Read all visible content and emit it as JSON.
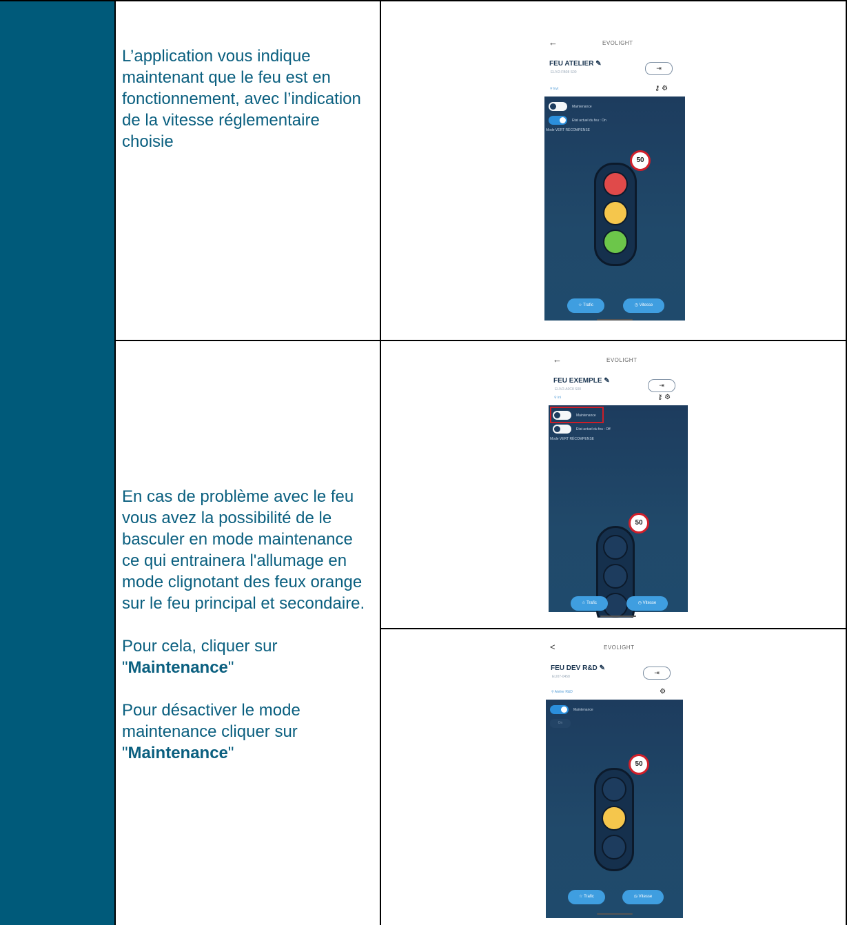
{
  "instructions": {
    "row1_text": "L’application vous indique maintenant que le feu est en fonctionnement, avec l’indication de la vitesse réglementaire choisie",
    "row2_para1": "En cas de problème avec le feu vous avez la possibilité de le basculer en mode maintenance ce qui entrainera l'allumage en mode clignotant des feux orange sur le feu principal et secondaire.",
    "row2_para2_prefix": "Pour cela, cliquer sur",
    "row2_para2_bold": "Maintenance",
    "row2_para3_prefix": "Pour désactiver le mode maintenance cliquer sur",
    "row2_para3_bold": "Maintenance",
    "quote": "\""
  },
  "screens": [
    {
      "back": "←",
      "brand": "EVOLIGHT",
      "device_name": "FEU ATELIER",
      "serial": "ELIV2-FB08 S00",
      "exit_icon": "exit-icon",
      "location": "Evt",
      "show_key_icon": true,
      "maintenance_label": "Maintenance",
      "maintenance_on": false,
      "state_label": "Etat actuel du feu : On",
      "state_on": true,
      "mode_label": "Mode VERT RÉCOMPENSE",
      "speed": "50",
      "lamps": [
        "#e04a4a",
        "#f5c64c",
        "#6cc64a"
      ],
      "trafic_label": "Trafic",
      "vitesse_label": "Vitesse",
      "highlight_maintenance": false
    },
    {
      "back": "←",
      "brand": "EVOLIGHT",
      "device_name": "FEU EXEMPLE",
      "serial": "ELIV2-A0C8 S00",
      "exit_icon": "exit-icon",
      "location": "ini",
      "show_key_icon": true,
      "maintenance_label": "Maintenance",
      "maintenance_on": false,
      "state_label": "Etat actuel du feu : Off",
      "state_on": false,
      "mode_label": "Mode VERT RÉCOMPENSE",
      "speed": "50",
      "lamps": [
        "#1d3c5e",
        "#1d3c5e",
        "#1d3c5e"
      ],
      "trafic_label": "Trafic",
      "vitesse_label": "Vitesse",
      "highlight_maintenance": true
    },
    {
      "back": "<",
      "brand": "EVOLIGHT",
      "device_name": "FEU DEV R&D",
      "serial": "ELI07-0458",
      "exit_icon": "exit-icon",
      "location": "Atelier R&D",
      "show_key_icon": false,
      "maintenance_label": "Maintenance",
      "maintenance_on": true,
      "off_chip": "On",
      "speed": "50",
      "lamps": [
        "#1d3c5e",
        "#f5c64c",
        "#1d3c5e"
      ],
      "trafic_label": "Trafic",
      "vitesse_label": "Vitesse",
      "highlight_maintenance": false
    }
  ]
}
